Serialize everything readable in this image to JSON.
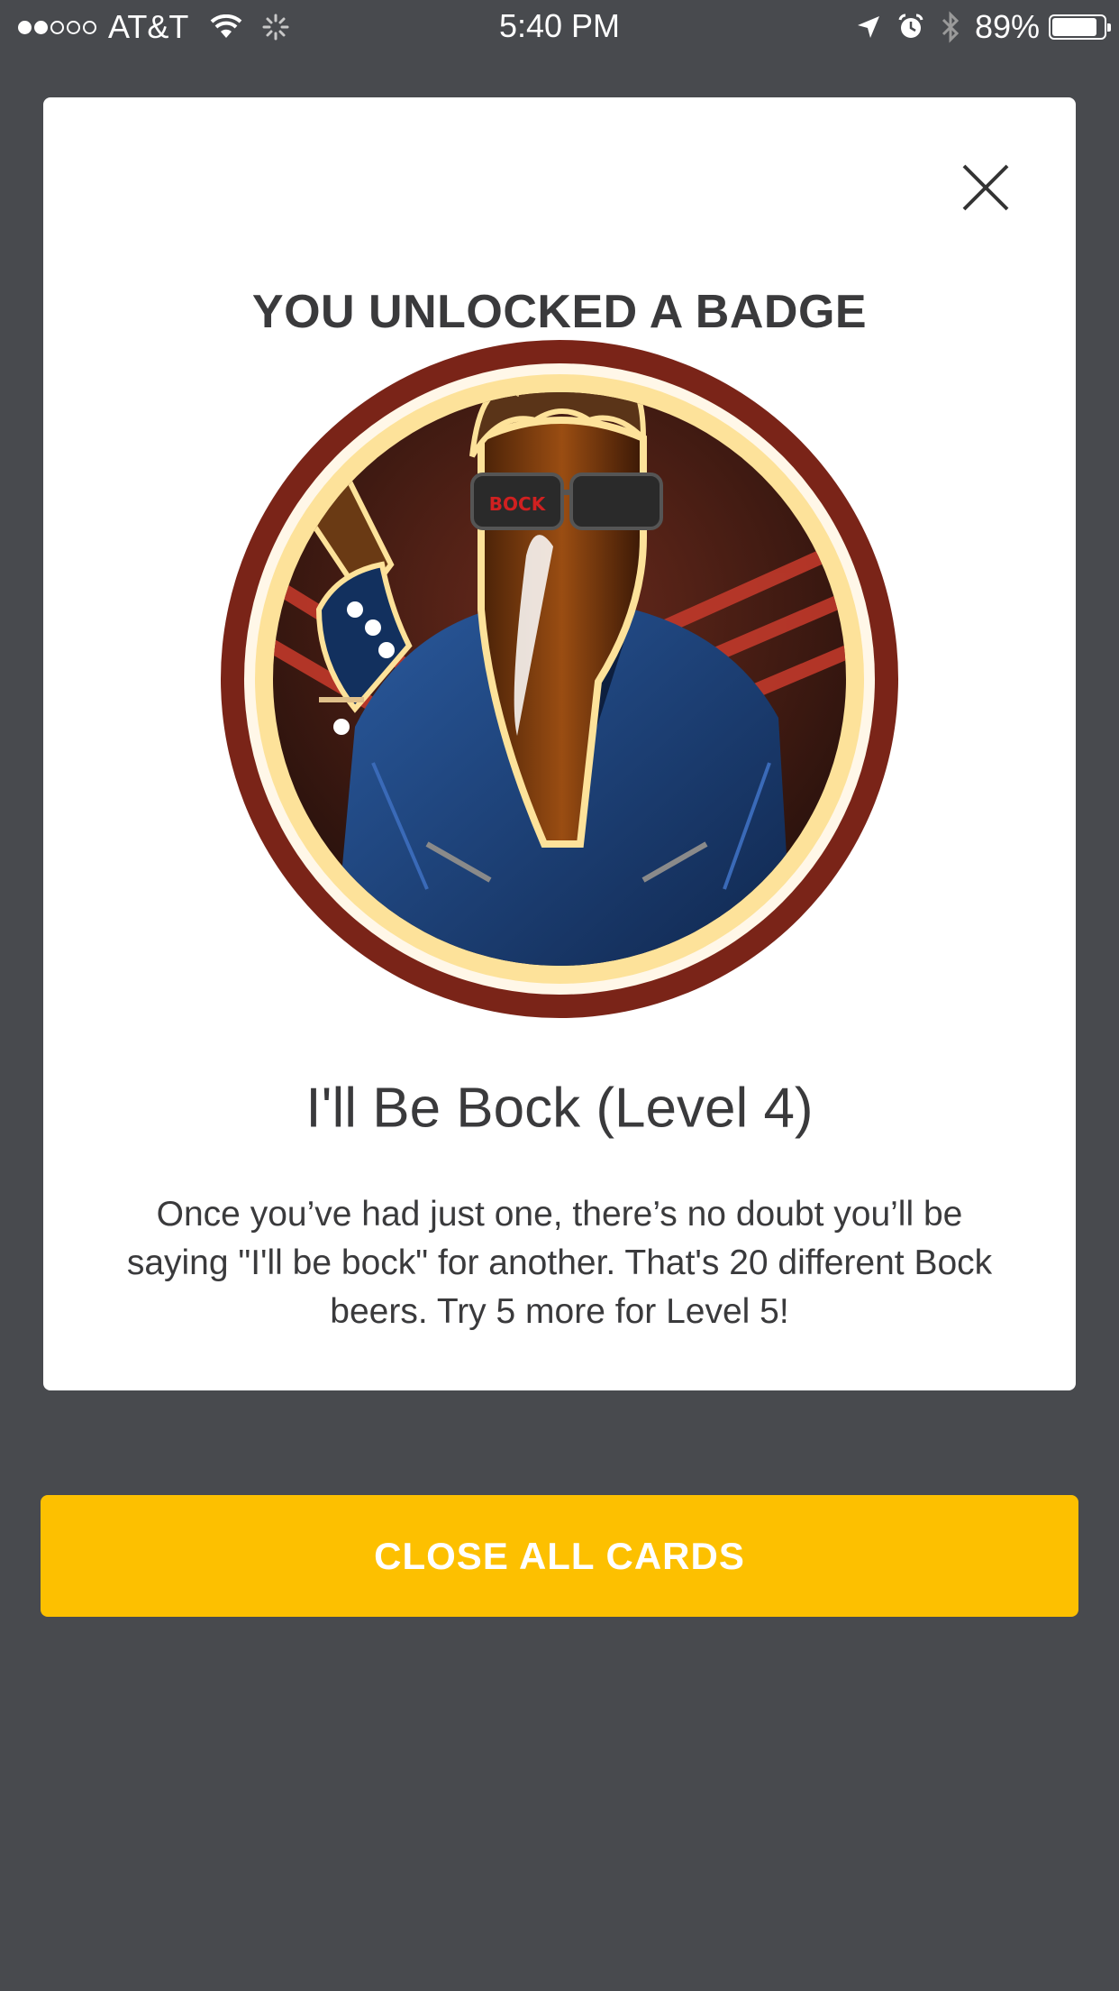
{
  "status_bar": {
    "carrier": "AT&T",
    "time": "5:40 PM",
    "battery_percent": "89%",
    "battery_level": 0.89,
    "signal_bars_filled": 2,
    "signal_bars_total": 5
  },
  "card": {
    "title": "YOU UNLOCKED A BADGE",
    "badge_name": "I'll Be Bock (Level 4)",
    "badge_description": "Once you’ve had just one, there’s no doubt you’ll be saying \"I'll be bock\" for another. That's 20 different Bock beers. Try 5 more for Level 5!",
    "badge_sunglasses_text": "BOCK",
    "close_icon": "close-icon"
  },
  "actions": {
    "close_all_label": "CLOSE ALL CARDS"
  },
  "colors": {
    "background": "#484a4e",
    "card": "#ffffff",
    "accent_yellow": "#fdc000",
    "text_dark": "#3a3a3c",
    "badge_ring": "#7a2418",
    "badge_inner_ring": "#fde29a",
    "jacket_blue": "#1d3a6e"
  }
}
